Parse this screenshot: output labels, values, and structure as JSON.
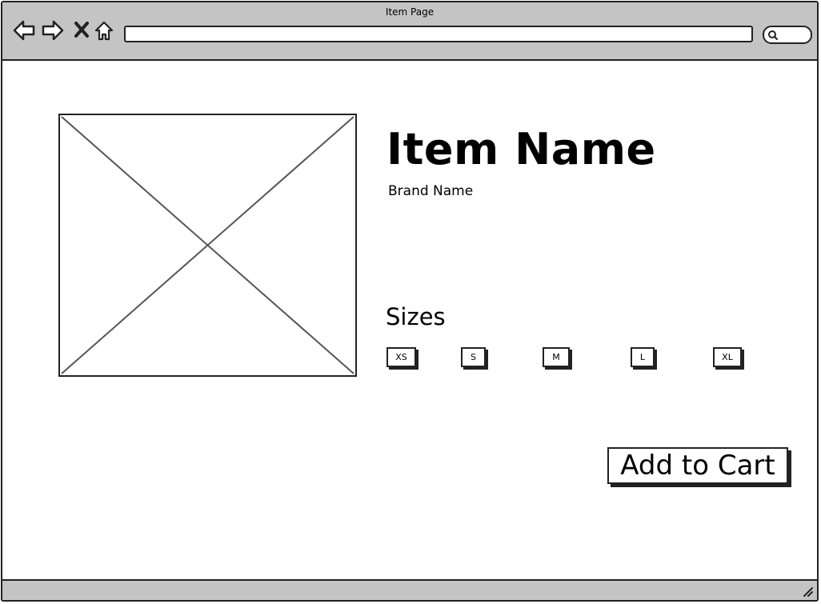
{
  "window": {
    "title": "Item Page"
  },
  "navigation": {
    "back_icon": "arrow-left-icon",
    "forward_icon": "arrow-right-icon",
    "stop_icon": "close-icon",
    "home_icon": "home-icon",
    "url_value": ""
  },
  "search": {
    "icon": "search-icon",
    "value": ""
  },
  "product": {
    "image_icon": "image-placeholder",
    "name": "Item Name",
    "brand": "Brand Name"
  },
  "sizes": {
    "label": "Sizes",
    "options": [
      "XS",
      "S",
      "M",
      "L",
      "XL"
    ]
  },
  "actions": {
    "add_to_cart": "Add to Cart"
  },
  "colors": {
    "chrome": "#c4c4c4",
    "border": "#222222",
    "background": "#ffffff"
  }
}
